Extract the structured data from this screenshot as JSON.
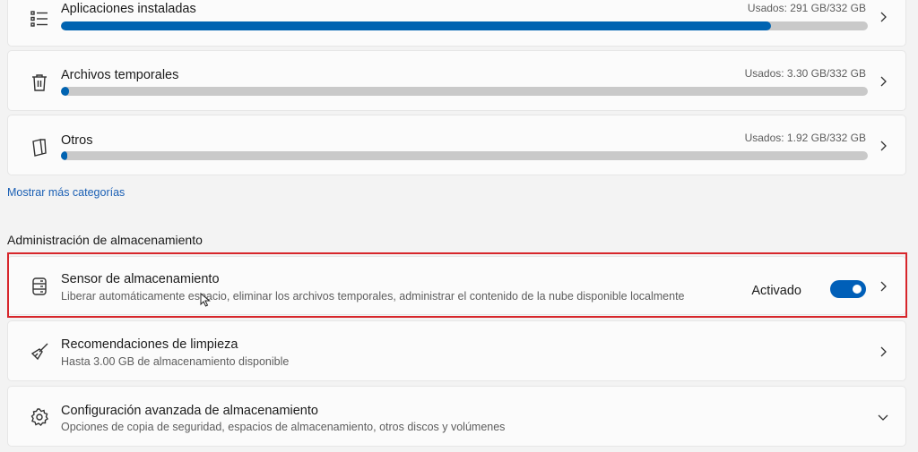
{
  "storage_categories": [
    {
      "label": "Aplicaciones instaladas",
      "usage": "Usados: 291 GB/332 GB",
      "percent": 88,
      "icon": "list-icon"
    },
    {
      "label": "Archivos temporales",
      "usage": "Usados: 3.30 GB/332 GB",
      "percent": 1,
      "icon": "trash-icon"
    },
    {
      "label": "Otros",
      "usage": "Usados: 1.92 GB/332 GB",
      "percent": 0.6,
      "icon": "documents-icon"
    }
  ],
  "show_more_link": "Mostrar más categorías",
  "management_section": {
    "title": "Administración de almacenamiento",
    "storage_sense": {
      "title": "Sensor de almacenamiento",
      "subtitle": "Liberar automáticamente espacio, eliminar los archivos temporales, administrar el contenido de la nube disponible localmente",
      "toggle_label": "Activado",
      "toggle_on": true,
      "icon": "storage-drive-icon"
    },
    "cleanup_recommendations": {
      "title": "Recomendaciones de limpieza",
      "subtitle": "Hasta 3.00 GB de almacenamiento disponible",
      "icon": "broom-icon"
    },
    "advanced_settings": {
      "title": "Configuración avanzada de almacenamiento",
      "subtitle": "Opciones de copia de seguridad, espacios de almacenamiento, otros discos y volúmenes",
      "icon": "gear-icon"
    }
  },
  "colors": {
    "accent": "#0063b1",
    "highlight_border": "#d7262b",
    "bar_track": "#c9c9c9"
  }
}
